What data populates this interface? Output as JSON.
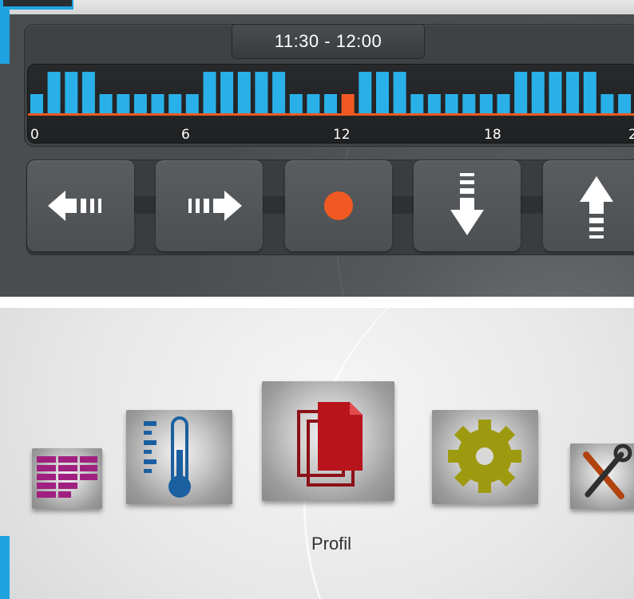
{
  "schedule": {
    "time_range": "11:30 - 12:00",
    "hour_ticks": [
      "0",
      "6",
      "12",
      "18",
      "2"
    ]
  },
  "chart_data": {
    "type": "bar",
    "title": "",
    "slot_levels": [
      1,
      2,
      2,
      2,
      1,
      1,
      1,
      1,
      1,
      1,
      2,
      2,
      2,
      2,
      2,
      1,
      1,
      1,
      2,
      2,
      2,
      2,
      1,
      1,
      1,
      1,
      1,
      1,
      2,
      2,
      2,
      2,
      2,
      1,
      1
    ],
    "selected_slot": 18,
    "colors": {
      "bar": "#2ab0e8",
      "selected": "#f05a22",
      "baseline": "#f05a22"
    }
  },
  "controls": {
    "items": [
      {
        "name": "arrow-left",
        "icon": "left-arrow-icon"
      },
      {
        "name": "arrow-right",
        "icon": "right-arrow-icon"
      },
      {
        "name": "record",
        "icon": "record-dot-icon"
      },
      {
        "name": "arrow-down",
        "icon": "down-arrow-icon"
      },
      {
        "name": "arrow-up",
        "icon": "up-arrow-icon"
      }
    ],
    "record_color": "#f05a22"
  },
  "menu": {
    "selected_label": "Profil",
    "tiles": [
      {
        "icon": "schedule-grid-icon"
      },
      {
        "icon": "thermometer-icon"
      },
      {
        "icon": "profile-documents-icon"
      },
      {
        "icon": "gear-icon"
      },
      {
        "icon": "tools-icon"
      }
    ]
  }
}
